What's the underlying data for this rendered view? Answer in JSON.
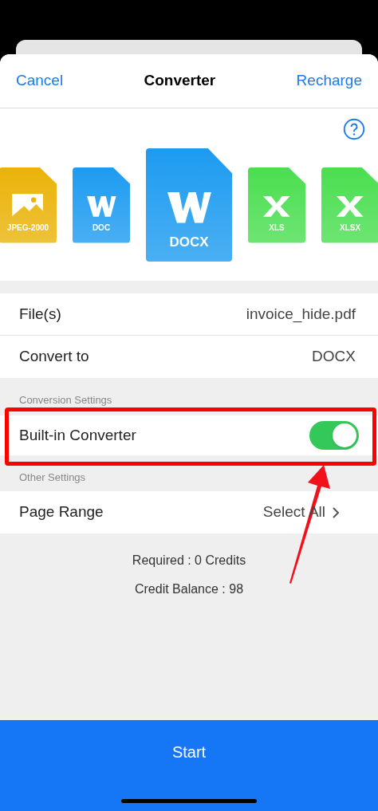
{
  "nav": {
    "cancel": "Cancel",
    "title": "Converter",
    "recharge": "Recharge"
  },
  "formats": [
    {
      "label": "JPEG-2000",
      "kind": "image",
      "color": "#eab308",
      "selected": false
    },
    {
      "label": "DOC",
      "kind": "word",
      "color": "#1d9bf0",
      "selected": false
    },
    {
      "label": "DOCX",
      "kind": "word",
      "color": "#1d9bf0",
      "selected": true
    },
    {
      "label": "XLS",
      "kind": "sheet",
      "color": "#4ade50",
      "selected": false
    },
    {
      "label": "XLSX",
      "kind": "sheet",
      "color": "#4ade50",
      "selected": false
    }
  ],
  "file_rows": [
    {
      "label": "File(s)",
      "value": "invoice_hide.pdf"
    },
    {
      "label": "Convert to",
      "value": "DOCX"
    }
  ],
  "conversion_settings": {
    "header": "Conversion Settings",
    "label": "Built-in Converter",
    "on": true,
    "highlighted": true
  },
  "other_settings": {
    "header": "Other Settings",
    "label": "Page Range",
    "value": "Select All"
  },
  "credits": [
    "Required : 0 Credits",
    "Credit Balance : 98"
  ],
  "start_button": "Start"
}
